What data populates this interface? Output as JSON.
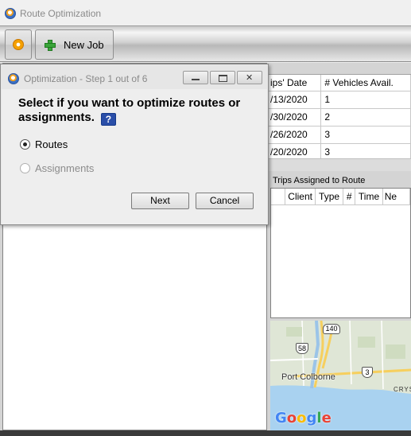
{
  "app": {
    "title": "Route Optimization"
  },
  "toolbar": {
    "new_job_label": "New Job"
  },
  "vehicles_grid": {
    "headers": [
      "ips' Date",
      "# Vehicles Avail."
    ],
    "rows": [
      [
        "/13/2020",
        "1"
      ],
      [
        "/30/2020",
        "2"
      ],
      [
        "/26/2020",
        "3"
      ],
      [
        "/20/2020",
        "3"
      ]
    ]
  },
  "trips_panel": {
    "label": "Trips Assigned to Route",
    "headers": [
      "",
      "Client",
      "Type",
      "#",
      "Time",
      "Ne"
    ]
  },
  "map": {
    "city": "Port Colborne",
    "partial_label": "CRYS",
    "shields": [
      "140",
      "58",
      "3"
    ],
    "logo": "Google",
    "colors": {
      "water": "#a9d2f0",
      "land": "#dfe6d6",
      "road": "#f6cf5e"
    }
  },
  "dialog": {
    "title": "Optimization - Step 1 out of 6",
    "prompt": "Select if you want to optimize routes or assignments.",
    "help_glyph": "?",
    "options": [
      {
        "label": "Routes",
        "selected": true,
        "enabled": true
      },
      {
        "label": "Assignments",
        "selected": false,
        "enabled": false
      }
    ],
    "next_label": "Next",
    "cancel_label": "Cancel"
  }
}
